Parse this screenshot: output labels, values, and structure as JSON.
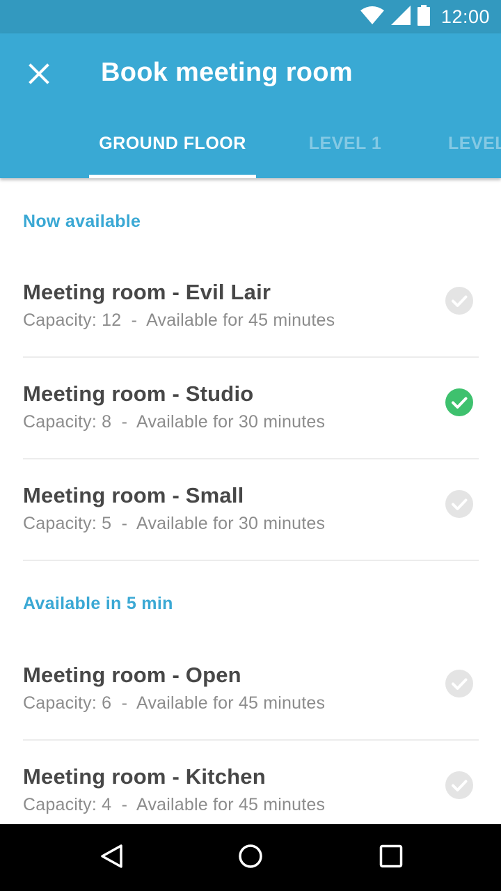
{
  "status_bar": {
    "time": "12:00",
    "icons": [
      "wifi-icon",
      "signal-icon",
      "battery-icon"
    ]
  },
  "app_bar": {
    "title": "Book meeting room",
    "close_icon": "close-icon",
    "tabs": [
      {
        "label": "GROUND FLOOR",
        "selected": true
      },
      {
        "label": "LEVEL 1",
        "selected": false
      },
      {
        "label": "LEVEL",
        "selected": false
      }
    ]
  },
  "sections": [
    {
      "header": "Now available",
      "rooms": [
        {
          "name": "Meeting room - Evil Lair",
          "capacity": "Capacity: 12",
          "separator": "-",
          "availability": "Available for 45 minutes",
          "selected": false
        },
        {
          "name": "Meeting room - Studio",
          "capacity": "Capacity: 8",
          "separator": "-",
          "availability": "Available for 30 minutes",
          "selected": true
        },
        {
          "name": "Meeting room - Small",
          "capacity": "Capacity: 5",
          "separator": "-",
          "availability": "Available for 30 minutes",
          "selected": false
        }
      ]
    },
    {
      "header": "Available in 5 min",
      "rooms": [
        {
          "name": "Meeting room - Open",
          "capacity": "Capacity: 6",
          "separator": "-",
          "availability": "Available for 45 minutes",
          "selected": false
        },
        {
          "name": "Meeting room - Kitchen",
          "capacity": "Capacity: 4",
          "separator": "-",
          "availability": "Available for 45 minutes",
          "selected": false
        }
      ]
    }
  ],
  "colors": {
    "status_bar": "#3399bf",
    "app_bar": "#39a9d4",
    "accent": "#3aa8d4",
    "check_selected": "#3ec16e",
    "check_unselected": "#e4e4e4"
  },
  "nav_bar": {
    "icons": [
      "back-icon",
      "home-icon",
      "recents-icon"
    ]
  }
}
